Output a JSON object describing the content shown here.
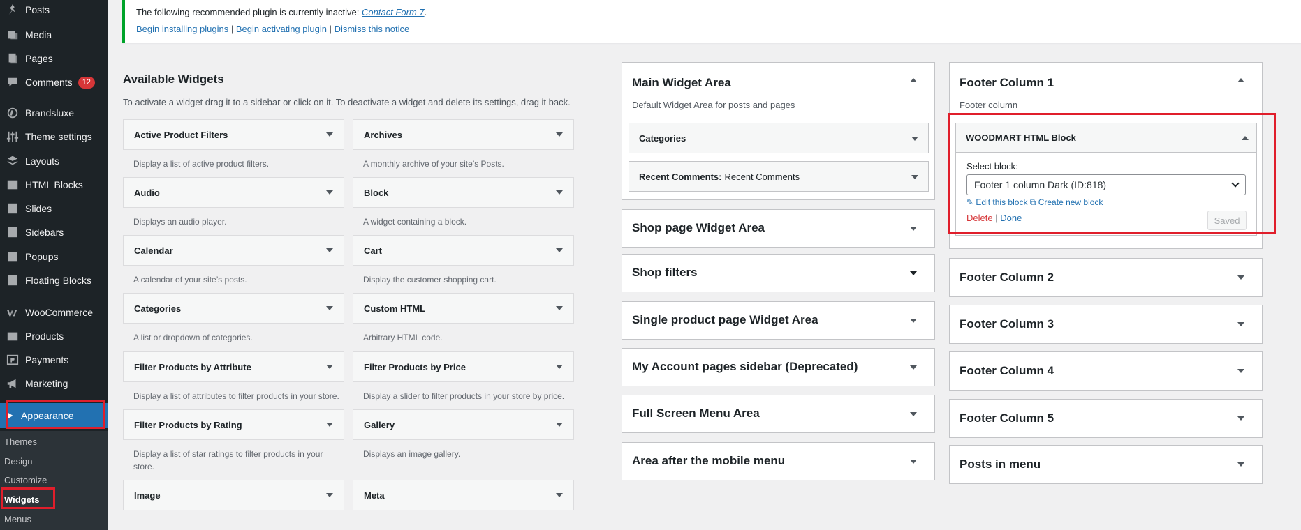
{
  "sidebar": {
    "items": [
      {
        "label": "Posts",
        "icon": "pin-icon"
      },
      {
        "label": "Media",
        "icon": "media-icon"
      },
      {
        "label": "Pages",
        "icon": "pages-icon"
      },
      {
        "label": "Comments",
        "icon": "comments-icon",
        "badge": "12"
      },
      {
        "label": "Brandsluxe",
        "icon": "brand-icon"
      },
      {
        "label": "Theme settings",
        "icon": "sliders-icon"
      },
      {
        "label": "Layouts",
        "icon": "layers-icon"
      },
      {
        "label": "HTML Blocks",
        "icon": "html-block-icon"
      },
      {
        "label": "Slides",
        "icon": "slides-icon"
      },
      {
        "label": "Sidebars",
        "icon": "sidebars-icon"
      },
      {
        "label": "Popups",
        "icon": "popups-icon"
      },
      {
        "label": "Floating Blocks",
        "icon": "floating-blocks-icon"
      },
      {
        "label": "WooCommerce",
        "icon": "woocommerce-icon"
      },
      {
        "label": "Products",
        "icon": "products-icon"
      },
      {
        "label": "Payments",
        "icon": "payments-icon"
      },
      {
        "label": "Marketing",
        "icon": "megaphone-icon"
      }
    ],
    "active": {
      "label": "Appearance",
      "icon": "brush-icon"
    },
    "submenu": [
      "Themes",
      "Design",
      "Customize",
      "Widgets",
      "Menus"
    ]
  },
  "notice": {
    "text": "The following recommended plugin is currently inactive: ",
    "plugin": "Contact Form 7",
    "period": ".",
    "links": [
      "Begin installing plugins",
      "Begin activating plugin",
      "Dismiss this notice"
    ],
    "sep": " | "
  },
  "available": {
    "title": "Available Widgets",
    "description": "To activate a widget drag it to a sidebar or click on it. To deactivate a widget and delete its settings, drag it back.",
    "widgets": [
      {
        "name": "Active Product Filters",
        "desc": "Display a list of active product filters."
      },
      {
        "name": "Archives",
        "desc": "A monthly archive of your site’s Posts."
      },
      {
        "name": "Audio",
        "desc": "Displays an audio player."
      },
      {
        "name": "Block",
        "desc": "A widget containing a block."
      },
      {
        "name": "Calendar",
        "desc": "A calendar of your site’s posts."
      },
      {
        "name": "Cart",
        "desc": "Display the customer shopping cart."
      },
      {
        "name": "Categories",
        "desc": "A list or dropdown of categories."
      },
      {
        "name": "Custom HTML",
        "desc": "Arbitrary HTML code."
      },
      {
        "name": "Filter Products by Attribute",
        "desc": "Display a list of attributes to filter products in your store."
      },
      {
        "name": "Filter Products by Price",
        "desc": "Display a slider to filter products in your store by price."
      },
      {
        "name": "Filter Products by Rating",
        "desc": "Display a list of star ratings to filter products in your store."
      },
      {
        "name": "Gallery",
        "desc": "Displays an image gallery."
      },
      {
        "name": "Image",
        "desc": ""
      },
      {
        "name": "Meta",
        "desc": ""
      }
    ]
  },
  "main_area": {
    "title": "Main Widget Area",
    "desc": "Default Widget Area for posts and pages",
    "widgets": [
      {
        "name": "Categories",
        "sub": ""
      },
      {
        "name": "Recent Comments:",
        "sub": "Recent Comments"
      }
    ]
  },
  "middle_areas": [
    "Shop page Widget Area",
    "Shop filters",
    "Single product page Widget Area",
    "My Account pages sidebar (Deprecated)",
    "Full Screen Menu Area",
    "Area after the mobile menu"
  ],
  "footer1": {
    "title": "Footer Column 1",
    "desc": "Footer column",
    "widget": {
      "title": "WOODMART HTML Block",
      "select_label": "Select block:",
      "selected": "Footer 1 column Dark (ID:818)",
      "edit_link": "Edit this block",
      "create_link": "Create new block",
      "delete": "Delete",
      "sep": "|",
      "done": "Done",
      "saved": "Saved"
    }
  },
  "right_areas": [
    "Footer Column 2",
    "Footer Column 3",
    "Footer Column 4",
    "Footer Column 5",
    "Posts in menu"
  ]
}
